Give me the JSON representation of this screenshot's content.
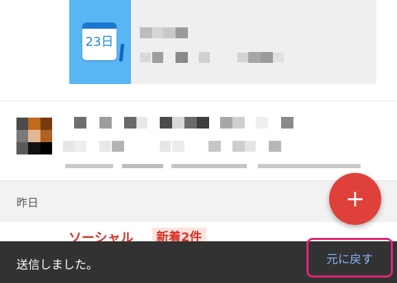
{
  "top_card": {
    "thumbnail_date": "23日",
    "thumbnail_icon": "calendar-icon"
  },
  "section": {
    "label": "昨日"
  },
  "social_message": {
    "category": "ソーシャル",
    "badge": "新着2件"
  },
  "fab": {
    "icon": "plus-icon",
    "label": "+"
  },
  "snackbar": {
    "message": "送信しました。",
    "undo_label": "元に戻す"
  },
  "colors": {
    "accent_red": "#e0403a",
    "snackbar_bg": "#323232",
    "undo_text": "#8ab4f8",
    "highlight_border": "#e2237a",
    "calendar_blue": "#58b6f5"
  }
}
